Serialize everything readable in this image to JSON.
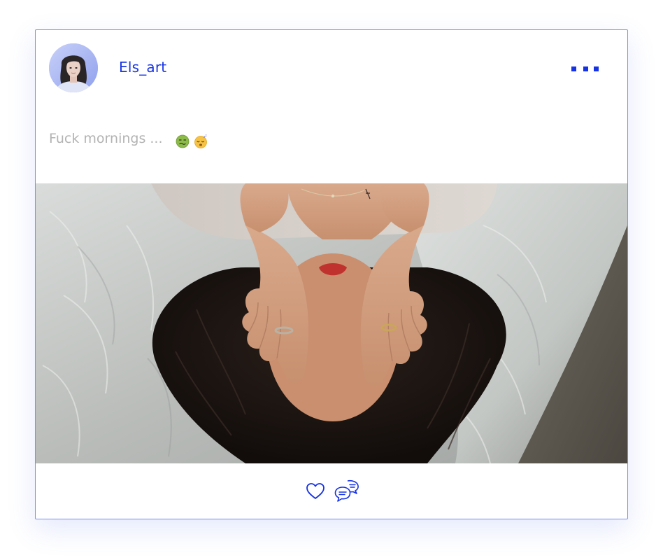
{
  "post": {
    "author": {
      "username": "Els_art",
      "avatar_icon": "profile-photo"
    },
    "menu_icon": "more-dots-icon",
    "caption": {
      "text": "Fuck mornings ...",
      "emojis": [
        "nauseated-face-emoji",
        "sleeping-face-emoji"
      ]
    },
    "photo_description_icon": "post-photo",
    "actions": {
      "like_icon": "heart-icon",
      "comment_icon": "comments-icon"
    }
  },
  "colors": {
    "accent": "#1532e6",
    "border": "#7d8ff0",
    "caption_text": "#b3b3b3",
    "background": "#ffffff"
  }
}
